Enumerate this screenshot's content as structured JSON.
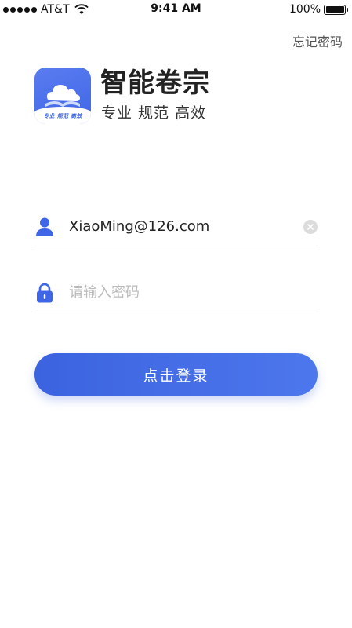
{
  "status_bar": {
    "carrier": "AT&T",
    "time": "9:41 AM",
    "battery": "100%"
  },
  "header": {
    "forgot_password": "忘记密码"
  },
  "brand": {
    "title": "智能卷宗",
    "slogan": "专业 规范 高效",
    "logo_tagline": "专业 规范 高效",
    "logo_icon": "cloud-book-icon"
  },
  "form": {
    "username": {
      "value": "XiaoMing@126.com",
      "placeholder": "",
      "icon": "user-icon"
    },
    "password": {
      "value": "",
      "placeholder": "请输入密码",
      "icon": "lock-icon"
    },
    "login_label": "点击登录"
  },
  "colors": {
    "accent": "#3f66e6",
    "text": "#222222",
    "muted": "#bbbbbb",
    "divider": "#e6e6e6"
  }
}
